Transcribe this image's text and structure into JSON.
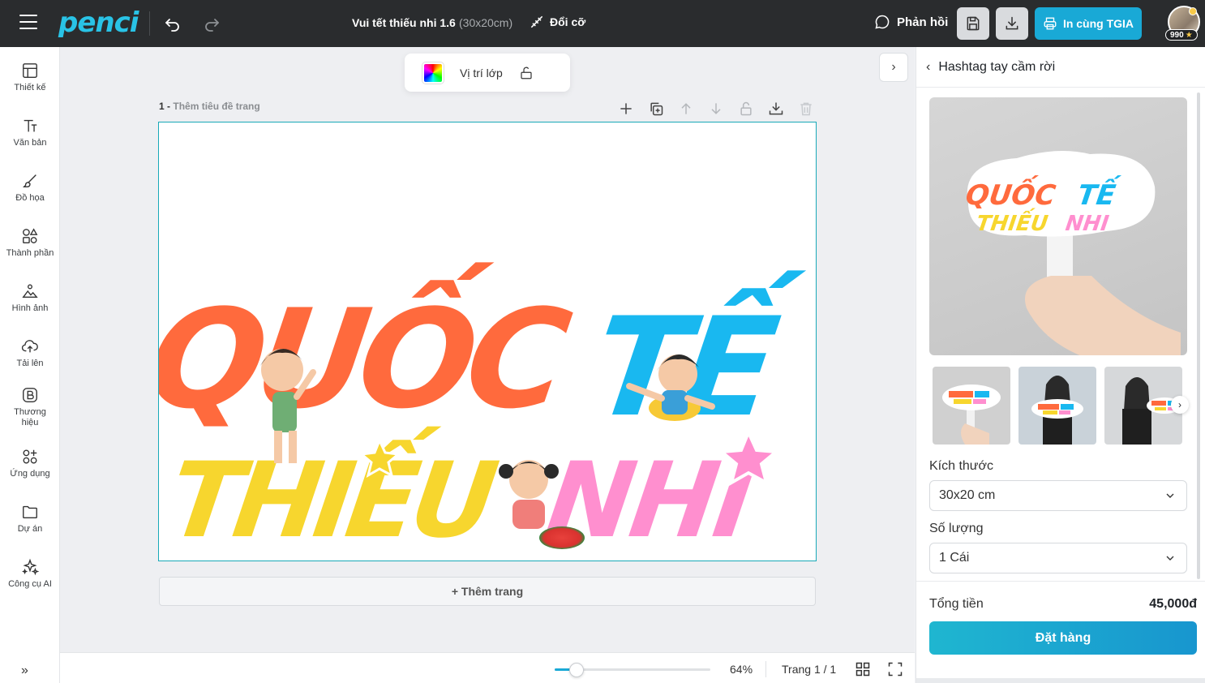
{
  "app": {
    "logo": "penci"
  },
  "header": {
    "doc_title": "Vui tết thiếu nhi 1.6",
    "doc_size": "(30x20cm)",
    "resize_label": "Đổi cỡ",
    "feedback_label": "Phản hồi",
    "print_label": "In cùng TGIA",
    "points": "990"
  },
  "sidebar": {
    "items": [
      {
        "label": "Thiết kế",
        "icon": "layout-icon"
      },
      {
        "label": "Văn bản",
        "icon": "text-icon"
      },
      {
        "label": "Đồ họa",
        "icon": "brush-icon"
      },
      {
        "label": "Thành phần",
        "icon": "elements-icon"
      },
      {
        "label": "Hình ảnh",
        "icon": "image-icon"
      },
      {
        "label": "Tải lên",
        "icon": "upload-icon"
      },
      {
        "label": "Thương hiệu",
        "icon": "brand-icon"
      },
      {
        "label": "Ứng dụng",
        "icon": "apps-icon"
      },
      {
        "label": "Dự án",
        "icon": "folder-icon"
      },
      {
        "label": "Công cụ AI",
        "icon": "sparkle-icon"
      }
    ],
    "expand_label": "»"
  },
  "canvas": {
    "layer_position_label": "Vị trí lớp",
    "page_number": "1 -",
    "page_title_placeholder": "Thêm tiêu đề trang",
    "add_page_label": "+ Thêm trang",
    "artwork": {
      "line1_word1": "QUỐC",
      "line1_word2": "TẾ",
      "line2_word1": "THIẾU",
      "line2_word2": "NHI"
    }
  },
  "footer": {
    "zoom_percent": 64,
    "zoom_label": "64%",
    "page_indicator": "Trang 1 / 1"
  },
  "panel": {
    "title": "Hashtag tay cầm rời",
    "size_label": "Kích thước",
    "size_value": "30x20 cm",
    "quantity_label": "Số lượng",
    "quantity_value": "1 Cái",
    "total_label": "Tổng tiền",
    "total_value": "45,000đ",
    "order_label": "Đặt hàng"
  },
  "colors": {
    "topbar": "#2a2c2e",
    "accent": "#19a9d6",
    "orange": "#ff6a3d",
    "blue": "#19b8f0",
    "yellow": "#f7d62e",
    "pink": "#ff8fcf"
  }
}
